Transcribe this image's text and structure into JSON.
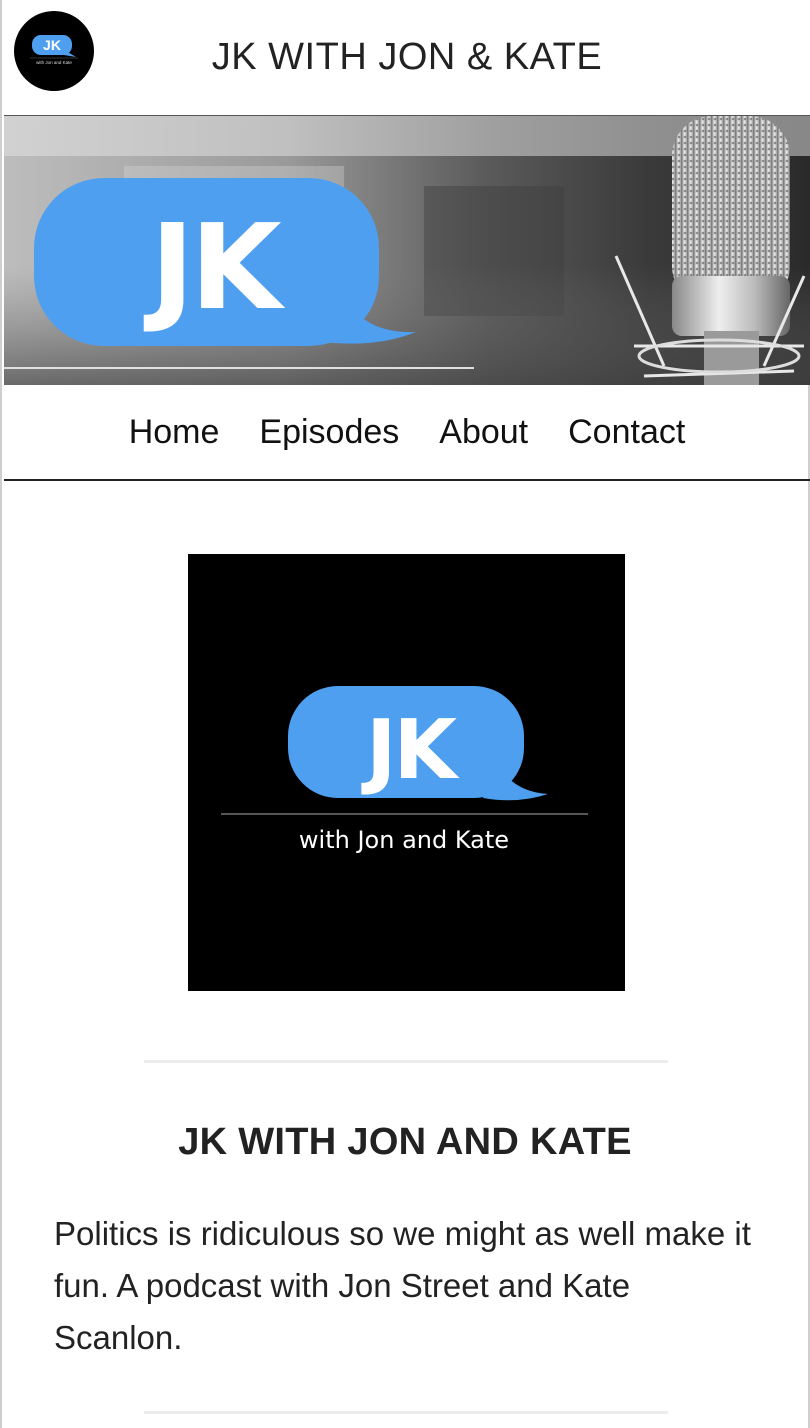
{
  "header": {
    "site_title": "JK WITH JON & KATE",
    "logo_text": "JK",
    "logo_subtext": "with Jon and Kate"
  },
  "hero": {
    "logo_text": "JK",
    "bubble_color": "#4f9ff0"
  },
  "nav": {
    "items": [
      {
        "label": "Home"
      },
      {
        "label": "Episodes"
      },
      {
        "label": "About"
      },
      {
        "label": "Contact"
      }
    ]
  },
  "cover": {
    "logo_text": "JK",
    "tagline": "with Jon and Kate"
  },
  "content": {
    "podcast_title": "JK WITH JON AND KATE",
    "description": "Politics is ridiculous so we might as well make it fun. A podcast with Jon Street and Kate Scanlon."
  },
  "colors": {
    "accent": "#4f9ff0",
    "text": "#222222",
    "background": "#ffffff"
  }
}
